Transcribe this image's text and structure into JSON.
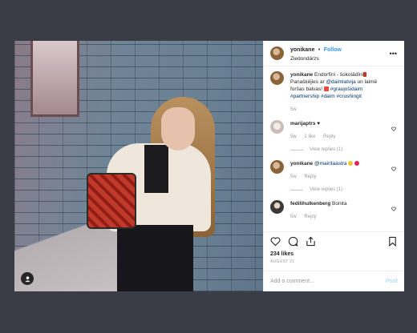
{
  "post": {
    "username": "yonikane",
    "follow_label": "Follow",
    "location": "Ziedondārzs",
    "more_label": "•••"
  },
  "comments": [
    {
      "username": "yonikane",
      "text_parts": [
        "Endorfīni - šokolādīni",
        " Panašķējies ar ",
        "@daimlatvija",
        " un laimē foršas balvas! ",
        "#graujošidaim",
        " ",
        "#partnership",
        " ",
        "#daim",
        " ",
        "#crushingit"
      ],
      "time": "5w"
    },
    {
      "username": "marijaptrs",
      "text": "♥",
      "time": "5w",
      "likes": "1 like",
      "reply_label": "Reply",
      "view_replies": "View replies (1)"
    },
    {
      "username": "yonikane",
      "mention": "@mairitaastra",
      "time": "5w",
      "reply_label": "Reply",
      "view_replies": "View replies (1)"
    },
    {
      "username": "fedilihulkenberg",
      "text": "Bonita",
      "time": "5w",
      "reply_label": "Reply"
    }
  ],
  "likes": "234 likes",
  "date": "AUGUST 21",
  "add_comment_placeholder": "Add a comment...",
  "post_label": "Post",
  "icons": [
    "heart-icon",
    "comment-icon",
    "share-icon",
    "bookmark-icon",
    "user-tag-icon",
    "more-icon"
  ],
  "colors": {
    "link": "#3897f0",
    "tag": "#003569",
    "muted": "#999999",
    "background": "#3a3d45"
  }
}
